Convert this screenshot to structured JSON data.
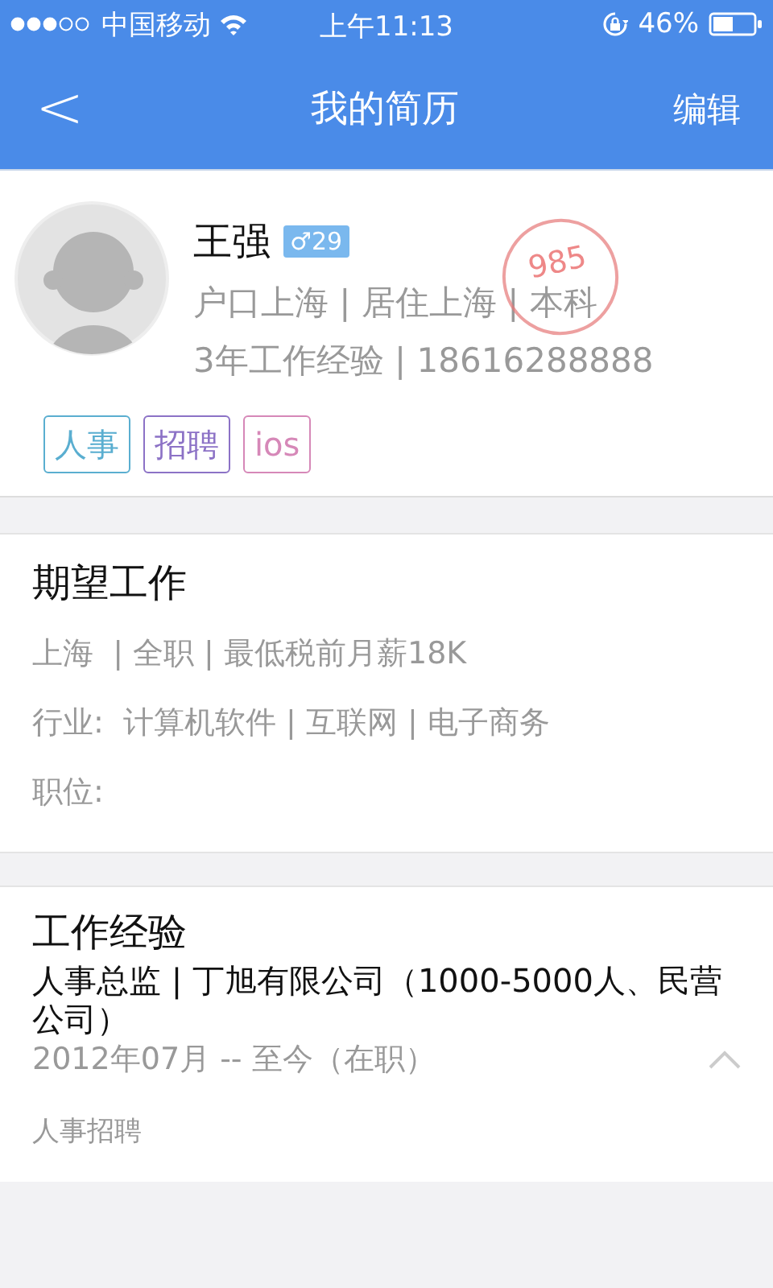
{
  "status_bar": {
    "carrier": "中国移动",
    "time": "上午11:13",
    "battery": "46%"
  },
  "nav": {
    "back": "<",
    "title": "我的简历",
    "action": "编辑"
  },
  "profile": {
    "name": "王强",
    "gender_age": "♂29",
    "stamp": "985",
    "line_1": "户口上海 | 居住上海 | 本科",
    "line_2": "3年工作经验 | 18616288888",
    "tags": [
      {
        "label": "人事",
        "color": "#5aaed0"
      },
      {
        "label": "招聘",
        "color": "#8c72c6"
      },
      {
        "label": "ios",
        "color": "#d688b8"
      }
    ]
  },
  "expectation": {
    "title": "期望工作",
    "lines": [
      "上海  | 全职 | 最低税前月薪18K",
      "行业:  计算机软件 | 互联网 | 电子商务",
      "职位:"
    ]
  },
  "experience": {
    "title": "工作经验",
    "job": "人事总监 | 丁旭有限公司（1000-5000人、民营公司）",
    "period": "2012年07月 -- 至今（在职）",
    "expanded": true,
    "description": "人事招聘"
  }
}
